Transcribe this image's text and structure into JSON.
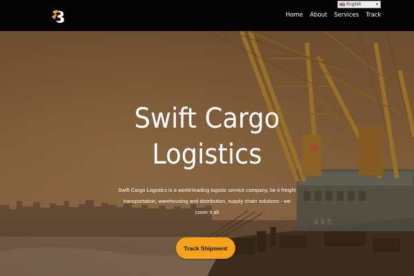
{
  "brand": {
    "logo_icon": "swift-cargo-logo-icon",
    "accent_color": "#f7a21b"
  },
  "nav": {
    "items": [
      {
        "label": "Home"
      },
      {
        "label": "About"
      },
      {
        "label": "Services"
      },
      {
        "label": "Track"
      }
    ]
  },
  "language": {
    "selected": "English",
    "flag_icon": "uk-flag-icon"
  },
  "hero": {
    "title_line1": "Swift Cargo",
    "title_line2": "Logistics",
    "description_line1": "Swift Cargo Logistics is a world-leading logistic service company, be it freight",
    "description_line2": "transportation, warehousing and distribution, supply chain solutions - we",
    "description_line3": "cover it all",
    "button_label": "Track Shipment"
  }
}
